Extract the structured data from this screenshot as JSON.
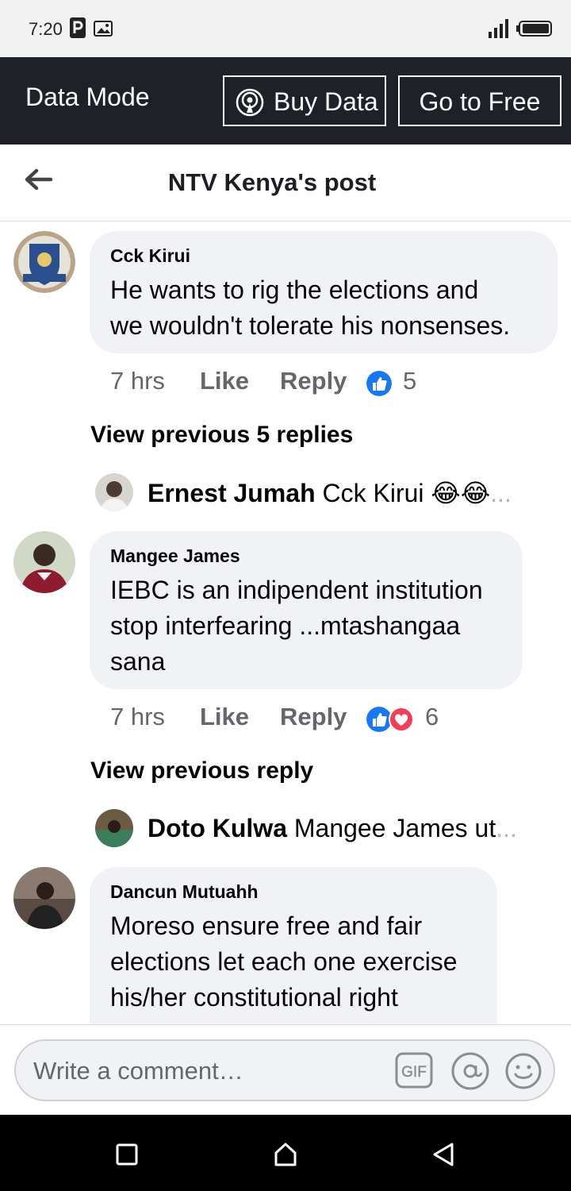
{
  "status_bar": {
    "time": "7:20"
  },
  "data_bar": {
    "mode_label": "Data Mode",
    "buy_data_label": "Buy Data",
    "go_free_label": "Go to Free"
  },
  "header": {
    "title": "NTV Kenya's post"
  },
  "comments": [
    {
      "author": "Cck Kirui",
      "text_lines": [
        "He wants to rig the elections and",
        "we wouldn't tolerate his nonsenses."
      ],
      "time": "7 hrs",
      "like_label": "Like",
      "reply_label": "Reply",
      "reactions": [
        "like"
      ],
      "reaction_count": "5",
      "view_previous": "View previous 5 replies",
      "reply_preview": {
        "name": "Ernest Jumah",
        "text": "Cck Kirui 😂😂",
        "ellipsis": "..."
      }
    },
    {
      "author": "Mangee James",
      "text_lines": [
        "IEBC is an indipendent institution",
        "stop interfearing ...mtashangaa",
        "sana"
      ],
      "time": "7 hrs",
      "like_label": "Like",
      "reply_label": "Reply",
      "reactions": [
        "like",
        "love"
      ],
      "reaction_count": "6",
      "view_previous": "View previous reply",
      "reply_preview": {
        "name": "Doto Kulwa",
        "text": "Mangee James ut",
        "ellipsis": "..."
      }
    },
    {
      "author": "Dancun Mutuahh",
      "text_lines": [
        "Moreso ensure free and fair",
        "elections let each one exercise",
        "his/her constitutional right"
      ]
    }
  ],
  "composer": {
    "placeholder": "Write a comment…"
  },
  "colors": {
    "data_bar_bg": "#1e2228",
    "bubble_bg": "#f0f2f5",
    "like_blue": "#1877f2",
    "love_red": "#f33e58",
    "haha_yellow": "#f7b125"
  },
  "icons": [
    "back-arrow-icon",
    "broadcast-icon",
    "gif-icon",
    "at-icon",
    "emoji-icon",
    "like-reaction-icon",
    "love-reaction-icon"
  ]
}
